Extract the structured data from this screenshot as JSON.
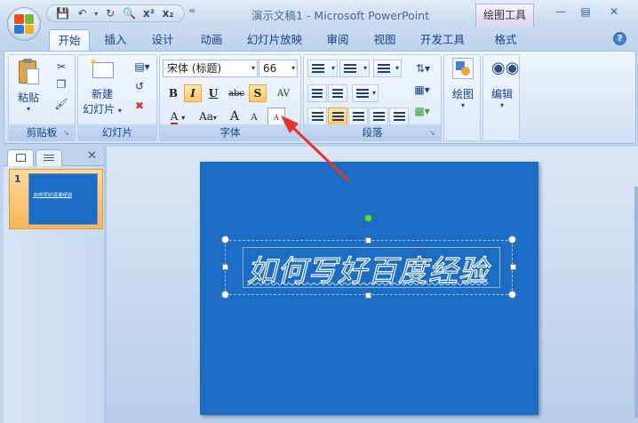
{
  "titlebar": {
    "title": "演示文稿1 - Microsoft PowerPoint",
    "context_tab": "绘图工具",
    "qat_more": "="
  },
  "tabs": [
    "开始",
    "插入",
    "设计",
    "动画",
    "幻灯片放映",
    "审阅",
    "视图",
    "开发工具",
    "格式"
  ],
  "ribbon": {
    "clipboard": {
      "paste": "粘贴",
      "label": "剪贴板"
    },
    "slides": {
      "new_slide_line1": "新建",
      "new_slide_line2": "幻灯片",
      "label": "幻灯片"
    },
    "font": {
      "font_name": "宋体 (标题)",
      "font_size": "66",
      "bold": "B",
      "italic": "I",
      "underline": "U",
      "strike": "abc",
      "shadow": "S",
      "spacing": "AV",
      "font_color": "A",
      "change_case": "Aa",
      "grow": "A",
      "shrink": "A",
      "clear": "A",
      "label": "字体"
    },
    "paragraph": {
      "label": "段落"
    },
    "drawing": {
      "label": "绘图"
    },
    "editing": {
      "label": "编辑"
    }
  },
  "pane": {
    "slide_number": "1",
    "thumb_text": "如何写好百度经验"
  },
  "slide": {
    "title": "如何写好百度经验",
    "background": "#1a6cc4"
  },
  "colors": {
    "accent": "#15428b",
    "highlight": "#ffc766",
    "arrow": "#e8322d"
  }
}
